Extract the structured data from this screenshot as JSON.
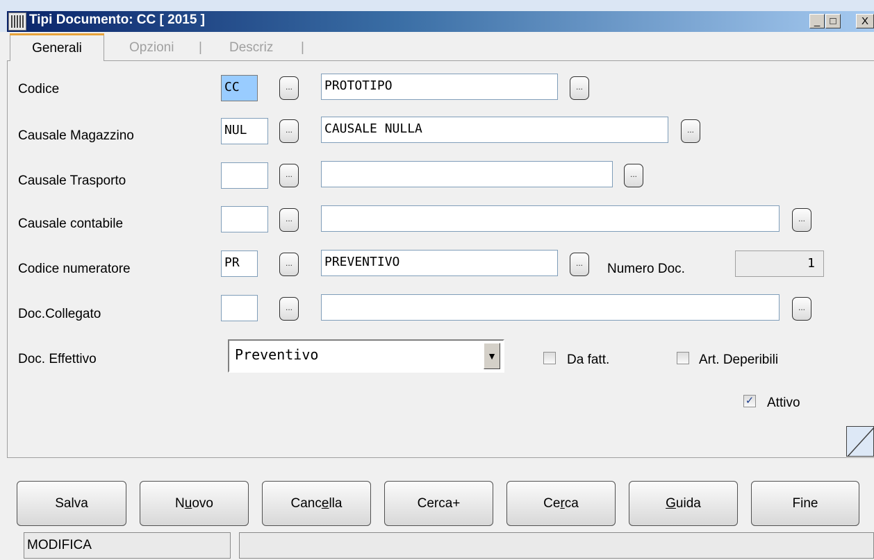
{
  "window": {
    "title": "Tipi Documento: CC [ 2015 ]",
    "minimize": "_",
    "maximize": "□",
    "close": "X"
  },
  "tabs": {
    "active": "Generali",
    "items": [
      "Opzioni",
      "Descriz"
    ],
    "separator": "|"
  },
  "form": {
    "codice": {
      "label": "Codice",
      "code": "CC",
      "desc": "PROTOTIPO"
    },
    "causale_magazzino": {
      "label": "Causale Magazzino",
      "code": "NUL",
      "desc": "CAUSALE NULLA"
    },
    "causale_trasporto": {
      "label": "Causale Trasporto",
      "code": "",
      "desc": ""
    },
    "causale_contabile": {
      "label": "Causale contabile",
      "code": "",
      "desc": ""
    },
    "codice_numeratore": {
      "label": "Codice numeratore",
      "code": "PR",
      "desc": "PREVENTIVO",
      "numero_label": "Numero Doc.",
      "numero_value": "1"
    },
    "doc_collegato": {
      "label": "Doc.Collegato",
      "code": "",
      "desc": ""
    },
    "doc_effettivo": {
      "label": "Doc. Effettivo",
      "value": "Preventivo"
    },
    "dots_label": "...",
    "da_fatt": {
      "label": "Da fatt.",
      "checked": false
    },
    "art_deperibili": {
      "label": "Art. Deperibili",
      "checked": false
    },
    "attivo": {
      "label": "Attivo",
      "checked": true,
      "mark": "✓"
    }
  },
  "buttons": {
    "salva": {
      "pre": "Salva",
      "mn": "",
      "post": ""
    },
    "nuovo": {
      "pre": "N",
      "mn": "u",
      "post": "ovo"
    },
    "cancella": {
      "pre": "Canc",
      "mn": "e",
      "post": "lla"
    },
    "cerca_plus": {
      "pre": "Cerca+",
      "mn": "",
      "post": ""
    },
    "cerca": {
      "pre": "Ce",
      "mn": "r",
      "post": "ca"
    },
    "guida": {
      "pre": "",
      "mn": "G",
      "post": "uida"
    },
    "fine": {
      "pre": "Fine",
      "mn": "",
      "post": ""
    }
  },
  "status": {
    "mode": "MODIFICA",
    "message": ""
  },
  "colors": {
    "title_start": "#0a246a",
    "title_end": "#a6caf0",
    "tab_accent": "#e8a33a",
    "selection": "#99ccff"
  }
}
